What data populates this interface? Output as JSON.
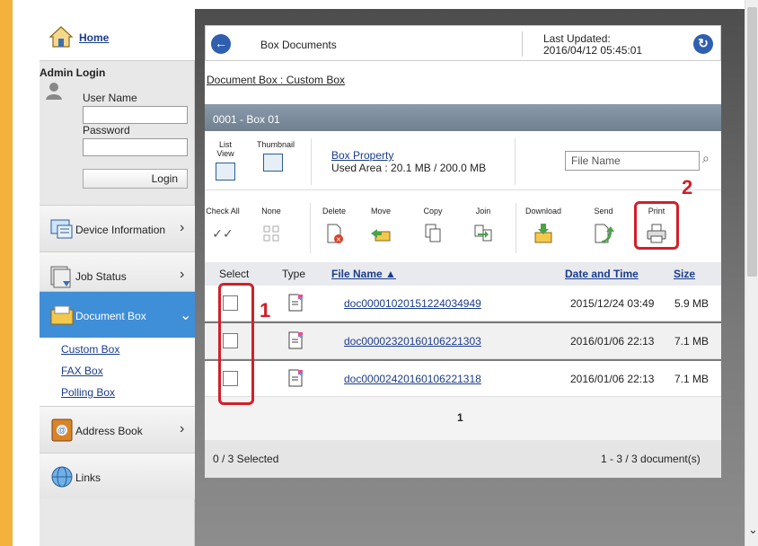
{
  "sidebar": {
    "home_label": "Home",
    "admin_login_title": "Admin Login",
    "user_name_label": "User Name",
    "user_name_value": "",
    "password_label": "Password",
    "password_value": "",
    "login_button": "Login",
    "nav_items": [
      {
        "label": "Device Information",
        "icon": "device-info-icon"
      },
      {
        "label": "Job Status",
        "icon": "job-status-icon"
      },
      {
        "label": "Document Box",
        "icon": "document-box-icon",
        "active": true
      },
      {
        "label": "Address Book",
        "icon": "address-book-icon"
      },
      {
        "label": "Links",
        "icon": "links-icon"
      }
    ],
    "sub_items": [
      "Custom Box",
      "FAX Box",
      "Polling Box"
    ]
  },
  "header": {
    "title": "Box Documents",
    "last_updated_label": "Last Updated:",
    "last_updated_value": "2016/04/12 05:45:01"
  },
  "breadcrumb": "Document Box : Custom Box",
  "box": {
    "title": "0001 - Box 01",
    "list_view_label": "List View",
    "thumbnail_label": "Thumbnail",
    "box_property_link": "Box Property",
    "used_area": "Used Area : 20.1 MB / 200.0 MB",
    "search_placeholder": "File Name"
  },
  "actions": [
    {
      "label": "Check All",
      "icon": "check-all-icon"
    },
    {
      "label": "None",
      "icon": "none-icon"
    },
    {
      "label": "Delete",
      "icon": "delete-icon"
    },
    {
      "label": "Move",
      "icon": "move-icon"
    },
    {
      "label": "Copy",
      "icon": "copy-icon"
    },
    {
      "label": "Join",
      "icon": "join-icon"
    },
    {
      "label": "Download",
      "icon": "download-icon"
    },
    {
      "label": "Send",
      "icon": "send-icon"
    },
    {
      "label": "Print",
      "icon": "print-icon"
    }
  ],
  "table": {
    "headers": {
      "select": "Select",
      "type": "Type",
      "file_name": "File Name ▲",
      "date": "Date and Time",
      "size": "Size"
    },
    "rows": [
      {
        "file_name": "doc00001020151224034949",
        "date": "2015/12/24 03:49",
        "size": "5.9 MB",
        "checked": false
      },
      {
        "file_name": "doc00002320160106221303",
        "date": "2016/01/06 22:13",
        "size": "7.1 MB",
        "checked": false
      },
      {
        "file_name": "doc00002420160106221318",
        "date": "2016/01/06 22:13",
        "size": "7.1 MB",
        "checked": false
      }
    ]
  },
  "pager": {
    "current_page": "1"
  },
  "footer": {
    "selected_count": "0 / 3 Selected",
    "document_range": "1 - 3 / 3 document(s)"
  },
  "callouts": {
    "one": "1",
    "two": "2"
  },
  "colors": {
    "accent_blue": "#3f8ed8",
    "link_blue": "#1a3c8c",
    "callout_red": "#d0202a",
    "side_gold": "#f3b23b"
  }
}
